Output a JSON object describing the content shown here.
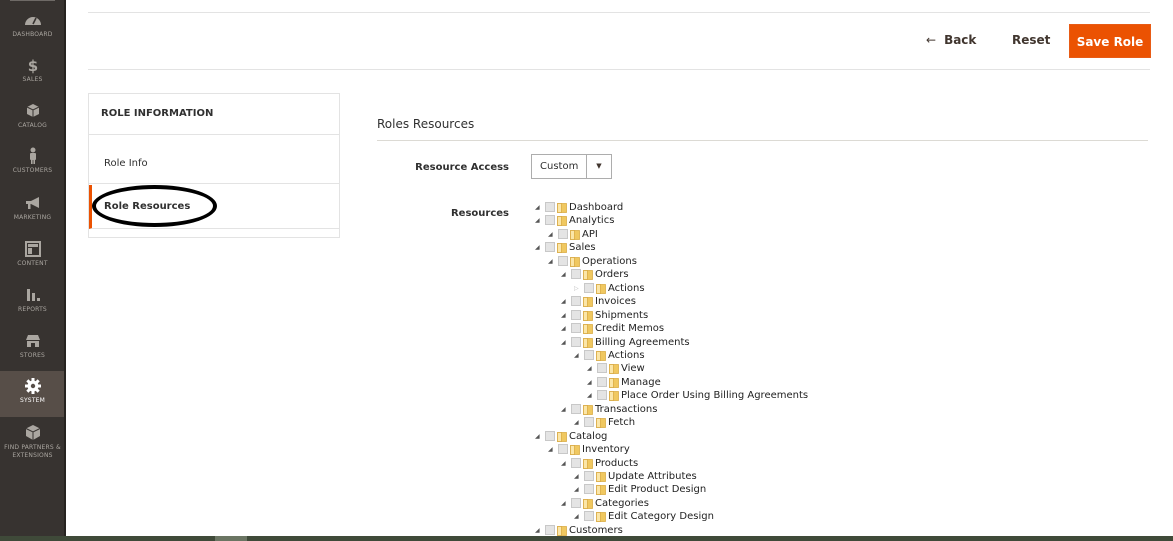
{
  "sidebar": {
    "items": [
      {
        "label": "DASHBOARD",
        "icon": "dashboard-icon",
        "active": false
      },
      {
        "label": "SALES",
        "icon": "dollar-icon",
        "active": false
      },
      {
        "label": "CATALOG",
        "icon": "box-icon",
        "active": false
      },
      {
        "label": "CUSTOMERS",
        "icon": "person-icon",
        "active": false
      },
      {
        "label": "MARKETING",
        "icon": "megaphone-icon",
        "active": false
      },
      {
        "label": "CONTENT",
        "icon": "layout-icon",
        "active": false
      },
      {
        "label": "REPORTS",
        "icon": "bar-chart-icon",
        "active": false
      },
      {
        "label": "STORES",
        "icon": "storefront-icon",
        "active": false
      },
      {
        "label": "SYSTEM",
        "icon": "gear-icon",
        "active": true
      },
      {
        "label": "FIND PARTNERS & EXTENSIONS",
        "icon": "cubes-icon",
        "active": false
      }
    ]
  },
  "actions": {
    "back_label": "Back",
    "back_icon": "←",
    "reset_label": "Reset",
    "save_label": "Save Role"
  },
  "tabs": {
    "title": "ROLE INFORMATION",
    "items": [
      {
        "label": "Role Info",
        "active": false
      },
      {
        "label": "Role Resources",
        "active": true
      }
    ]
  },
  "section": {
    "title": "Roles Resources",
    "resource_access_label": "Resource Access",
    "resource_access_value": "Custom",
    "resources_label": "Resources"
  },
  "tree": [
    {
      "label": "Dashboard",
      "level": 0,
      "expanded": true
    },
    {
      "label": "Analytics",
      "level": 0,
      "expanded": true
    },
    {
      "label": "API",
      "level": 1,
      "expanded": true
    },
    {
      "label": "Sales",
      "level": 0,
      "expanded": true
    },
    {
      "label": "Operations",
      "level": 1,
      "expanded": true
    },
    {
      "label": "Orders",
      "level": 2,
      "expanded": true
    },
    {
      "label": "Actions",
      "level": 3,
      "expanded": false
    },
    {
      "label": "Invoices",
      "level": 2,
      "expanded": true
    },
    {
      "label": "Shipments",
      "level": 2,
      "expanded": true
    },
    {
      "label": "Credit Memos",
      "level": 2,
      "expanded": true
    },
    {
      "label": "Billing Agreements",
      "level": 2,
      "expanded": true
    },
    {
      "label": "Actions",
      "level": 3,
      "expanded": true
    },
    {
      "label": "View",
      "level": 4,
      "expanded": true
    },
    {
      "label": "Manage",
      "level": 4,
      "expanded": true
    },
    {
      "label": "Place Order Using Billing Agreements",
      "level": 4,
      "expanded": true
    },
    {
      "label": "Transactions",
      "level": 2,
      "expanded": true
    },
    {
      "label": "Fetch",
      "level": 3,
      "expanded": true
    },
    {
      "label": "Catalog",
      "level": 0,
      "expanded": true
    },
    {
      "label": "Inventory",
      "level": 1,
      "expanded": true
    },
    {
      "label": "Products",
      "level": 2,
      "expanded": true
    },
    {
      "label": "Update Attributes",
      "level": 3,
      "expanded": true
    },
    {
      "label": "Edit Product Design",
      "level": 3,
      "expanded": true
    },
    {
      "label": "Categories",
      "level": 2,
      "expanded": true
    },
    {
      "label": "Edit Category Design",
      "level": 3,
      "expanded": true
    },
    {
      "label": "Customers",
      "level": 0,
      "expanded": true
    }
  ],
  "colors": {
    "accent": "#eb5202",
    "sidebar_bg": "#373330",
    "sidebar_active": "#574e48"
  }
}
